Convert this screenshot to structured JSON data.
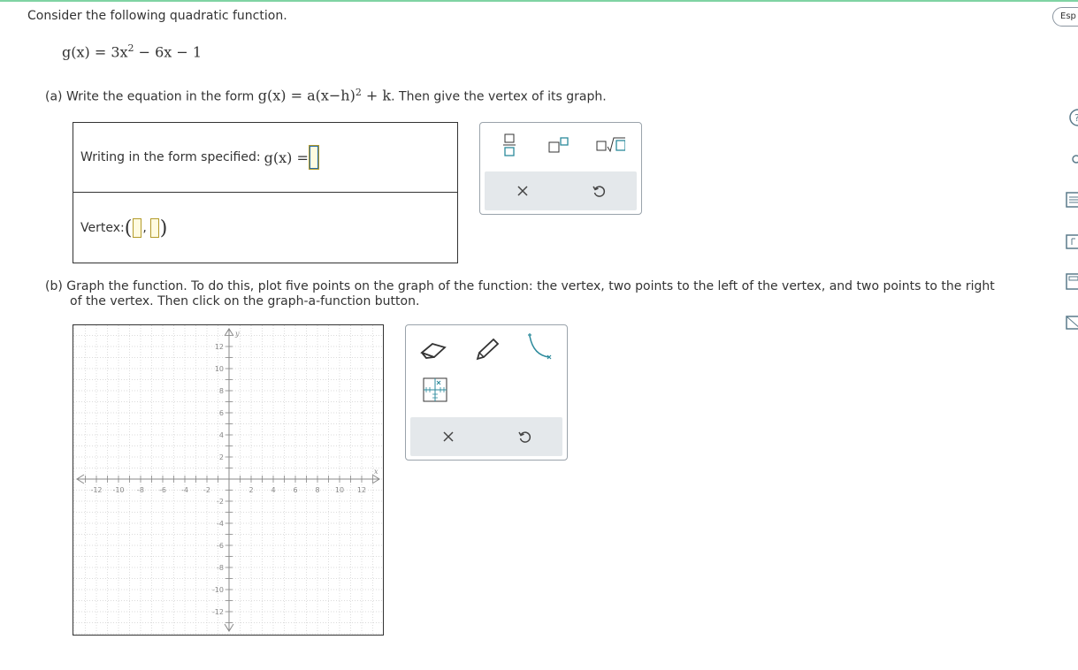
{
  "question": {
    "intro": "Consider the following quadratic function.",
    "function_lhs": "g(x) = 3x",
    "function_exp": "2",
    "function_rhs": " − 6x − 1",
    "part_a_prefix": "(a) Write the equation in the form ",
    "part_a_math": "g(x) = a(x−h)",
    "part_a_exp": "2",
    "part_a_math_end": " + k",
    "part_a_suffix": ". Then give the vertex of its graph.",
    "part_b_line1": "(b) Graph the function. To do this, plot five points on the graph of the function: the vertex, two points to the left of the vertex, and two points to the right",
    "part_b_line2": "of the vertex. Then click on the graph-a-function button."
  },
  "answer": {
    "form_label": "Writing in the form specified: ",
    "form_math": "g(x) = ",
    "vertex_label": "Vertex: "
  },
  "graph": {
    "x_axis_label": "x",
    "y_axis_label": "y",
    "x_ticks": [
      "-12",
      "-10",
      "-8",
      "-6",
      "-4",
      "-2",
      "2",
      "4",
      "6",
      "8",
      "10",
      "12"
    ],
    "y_ticks": [
      "12",
      "10",
      "8",
      "6",
      "4",
      "2",
      "-2",
      "-4",
      "-6",
      "-8",
      "-10",
      "-12"
    ]
  },
  "sidebar": {
    "language_button": "Esp"
  },
  "colors": {
    "accent": "#2b8a9c",
    "palette_footer": "#e4e8eb",
    "slot_border": "#b39b2a"
  },
  "icons": {
    "palette_a": [
      "fraction-icon",
      "exponent-icon",
      "square-root-icon",
      "clear-icon",
      "undo-icon"
    ],
    "palette_b": [
      "eraser-icon",
      "pencil-icon",
      "parabola-icon",
      "graph-function-icon",
      "clear-icon",
      "undo-icon"
    ]
  }
}
